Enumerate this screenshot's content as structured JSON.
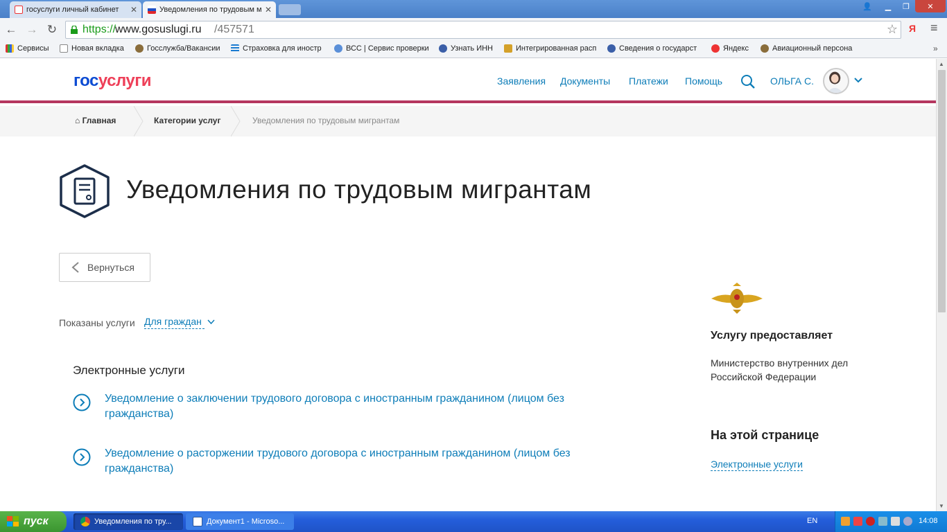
{
  "browser": {
    "tabs": [
      {
        "title": "госуслуги личный кабинет",
        "active": false
      },
      {
        "title": "Уведомления по трудовым м",
        "active": true
      }
    ],
    "url": {
      "protocol": "https://",
      "host": "www.gosuslugi.ru",
      "path": "/457571"
    },
    "bookmarks": [
      "Сервисы",
      "Новая вкладка",
      "Госслужба/Вакансии",
      "Страховка для иностр",
      "ВСС | Сервис проверки",
      "Узнать ИНН",
      "Интегрированная расп",
      "Сведения о государст",
      "Яндекс",
      "Авиационный персона"
    ]
  },
  "header": {
    "logo": {
      "part1": "гос",
      "part2": "услуги"
    },
    "nav": [
      "Заявления",
      "Документы",
      "Платежи",
      "Помощь"
    ],
    "user_name": "ОЛЬГА С."
  },
  "breadcrumbs": {
    "home": "Главная",
    "categories": "Категории услуг",
    "current": "Уведомления по трудовым мигрантам"
  },
  "main": {
    "title": "Уведомления по трудовым мигрантам",
    "back_label": "Вернуться",
    "shown_label": "Показаны услуги",
    "audience": "Для граждан",
    "section_heading": "Электронные услуги",
    "services": [
      "Уведомление о заключении трудового договора с иностранным гражданином (лицом без гражданства)",
      "Уведомление о расторжении трудового договора с иностранным гражданином (лицом без гражданства)"
    ]
  },
  "sidebar": {
    "provider_heading": "Услугу предоставляет",
    "provider_name": "Министерство внутренних дел Российской Федерации",
    "toc_heading": "На этой странице",
    "toc_link": "Электронные услуги"
  },
  "taskbar": {
    "start_label": "пуск",
    "tasks": [
      "Уведомления по тру...",
      "Документ1 - Microso..."
    ],
    "lang": "EN",
    "clock": "14:08"
  },
  "colors": {
    "link": "#0d7db8",
    "accent": "#b5365f",
    "logo_blue": "#0d4cd3",
    "logo_red": "#ee3f58"
  }
}
